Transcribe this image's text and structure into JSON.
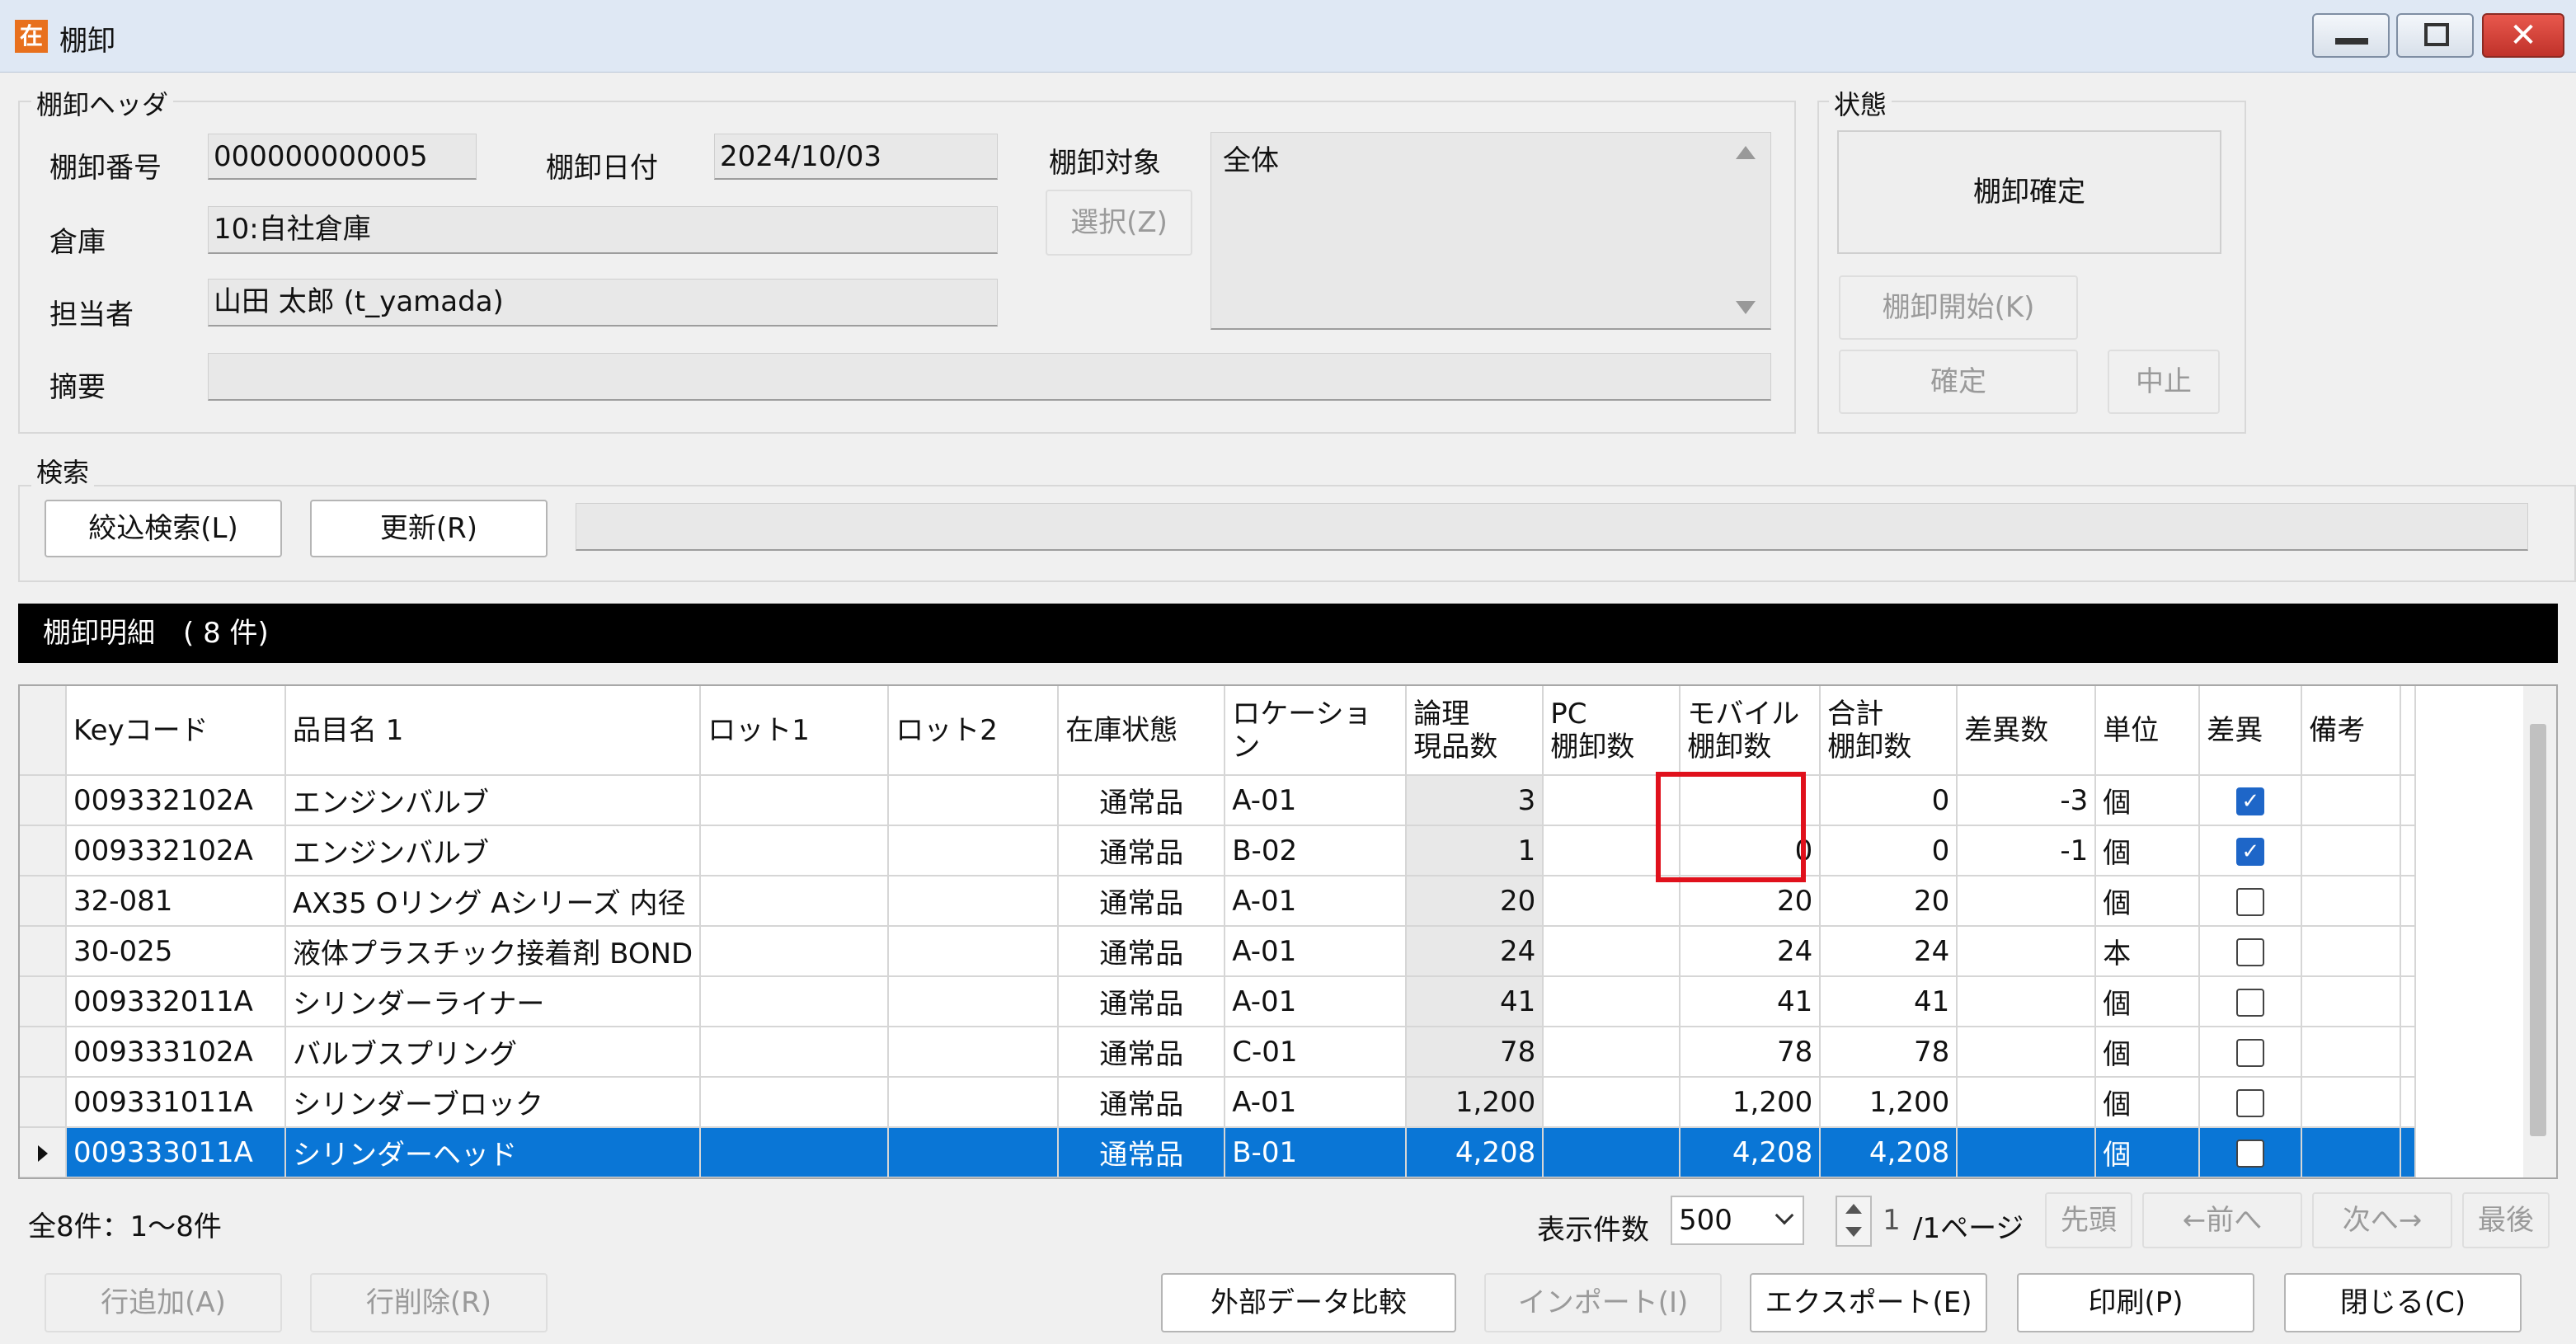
{
  "window": {
    "icon_glyph": "在",
    "title": "棚卸",
    "close_glyph": "✕"
  },
  "header": {
    "group_title": "棚卸ヘッダ",
    "number_label": "棚卸番号",
    "number_value": "000000000005",
    "date_label": "棚卸日付",
    "date_value": "2024/10/03",
    "target_label": "棚卸対象",
    "target_value": "全体",
    "select_button": "選択(Z)",
    "warehouse_label": "倉庫",
    "warehouse_value": "10:自社倉庫",
    "person_label": "担当者",
    "person_value": "山田 太郎 (t_yamada)",
    "note_label": "摘要",
    "note_value": ""
  },
  "status": {
    "group_title": "状態",
    "value": "棚卸確定",
    "start_button": "棚卸開始(K)",
    "confirm_button": "確定",
    "cancel_button": "中止"
  },
  "search": {
    "group_title": "検索",
    "filter_button": "絞込検索(L)",
    "refresh_button": "更新(R)",
    "text_value": ""
  },
  "detail": {
    "title": "棚卸明細　( 8 件)",
    "columns": [
      "Keyコード",
      "品目名 1",
      "ロット1",
      "ロット2",
      "在庫状態",
      "ロケーション",
      "論理\n現品数",
      "PC\n棚卸数",
      "モバイル\n棚卸数",
      "合計\n棚卸数",
      "差異数",
      "単位",
      "差異",
      "備考"
    ],
    "rows": [
      {
        "key": "009332102A",
        "name": "エンジンバルブ",
        "lot1": "",
        "lot2": "",
        "state": "通常品",
        "loc": "A-01",
        "logical": "3",
        "pc": "",
        "mobile": "",
        "total": "0",
        "diff": "-3",
        "unit": "個",
        "flag": true,
        "note": ""
      },
      {
        "key": "009332102A",
        "name": "エンジンバルブ",
        "lot1": "",
        "lot2": "",
        "state": "通常品",
        "loc": "B-02",
        "logical": "1",
        "pc": "",
        "mobile": "0",
        "total": "0",
        "diff": "-1",
        "unit": "個",
        "flag": true,
        "note": ""
      },
      {
        "key": "32-081",
        "name": "AX35 Oリング Aシリーズ 内径",
        "lot1": "",
        "lot2": "",
        "state": "通常品",
        "loc": "A-01",
        "logical": "20",
        "pc": "",
        "mobile": "20",
        "total": "20",
        "diff": "",
        "unit": "個",
        "flag": false,
        "note": ""
      },
      {
        "key": "30-025",
        "name": "液体プラスチック接着剤 BOND",
        "lot1": "",
        "lot2": "",
        "state": "通常品",
        "loc": "A-01",
        "logical": "24",
        "pc": "",
        "mobile": "24",
        "total": "24",
        "diff": "",
        "unit": "本",
        "flag": false,
        "note": ""
      },
      {
        "key": "009332011A",
        "name": "シリンダーライナー",
        "lot1": "",
        "lot2": "",
        "state": "通常品",
        "loc": "A-01",
        "logical": "41",
        "pc": "",
        "mobile": "41",
        "total": "41",
        "diff": "",
        "unit": "個",
        "flag": false,
        "note": ""
      },
      {
        "key": "009333102A",
        "name": "バルブスプリング",
        "lot1": "",
        "lot2": "",
        "state": "通常品",
        "loc": "C-01",
        "logical": "78",
        "pc": "",
        "mobile": "78",
        "total": "78",
        "diff": "",
        "unit": "個",
        "flag": false,
        "note": ""
      },
      {
        "key": "009331011A",
        "name": "シリンダーブロック",
        "lot1": "",
        "lot2": "",
        "state": "通常品",
        "loc": "A-01",
        "logical": "1,200",
        "pc": "",
        "mobile": "1,200",
        "total": "1,200",
        "diff": "",
        "unit": "個",
        "flag": false,
        "note": ""
      },
      {
        "key": "009333011A",
        "name": "シリンダーヘッド",
        "lot1": "",
        "lot2": "",
        "state": "通常品",
        "loc": "B-01",
        "logical": "4,208",
        "pc": "",
        "mobile": "4,208",
        "total": "4,208",
        "diff": "",
        "unit": "個",
        "flag": false,
        "note": ""
      }
    ],
    "selected_row": 7
  },
  "pager": {
    "summary": "全8件：1～8件",
    "page_size_label": "表示件数",
    "page_size_value": "500",
    "page_value": "1",
    "page_suffix": "/1ページ",
    "first": "先頭",
    "prev": "←前へ",
    "next": "次へ→",
    "last": "最後"
  },
  "footer": {
    "add_row": "行追加(A)",
    "delete_row": "行削除(R)",
    "compare": "外部データ比較",
    "import": "インポート(I)",
    "export": "エクスポート(E)",
    "print": "印刷(P)",
    "close": "閉じる(C)"
  },
  "colors": {
    "selected_row": "#0a76d6",
    "highlight_box": "#e0111c",
    "check_on": "#1e66c8"
  }
}
